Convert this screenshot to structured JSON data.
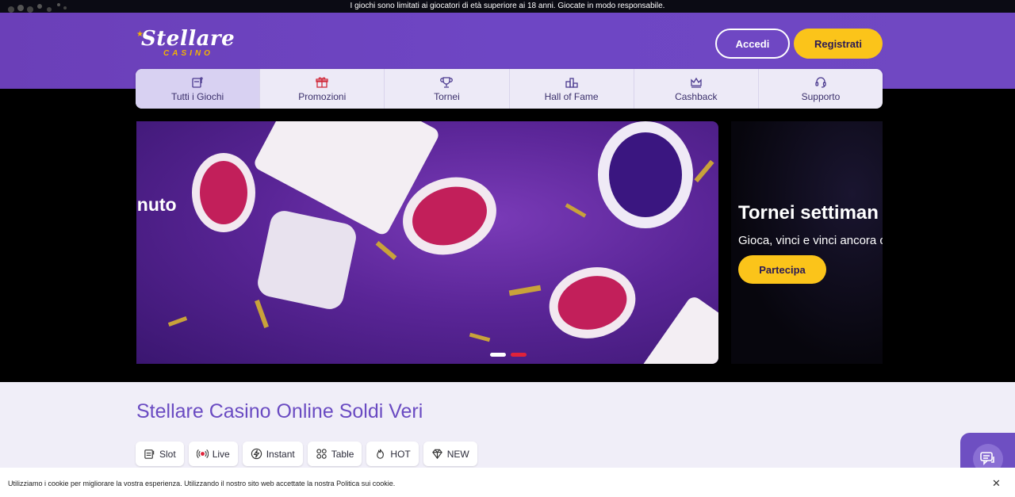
{
  "topbar": {
    "notice": "I giochi sono limitati ai giocatori di età superiore ai 18 anni. Giocate in modo responsabile."
  },
  "logo": {
    "main": "Stellare",
    "sub": "CASINO"
  },
  "header": {
    "login_label": "Accedi",
    "register_label": "Registrati"
  },
  "nav": {
    "items": [
      {
        "label": "Tutti i Giochi",
        "icon": "slot-machine-icon",
        "active": true
      },
      {
        "label": "Promozioni",
        "icon": "gift-icon",
        "active": false
      },
      {
        "label": "Tornei",
        "icon": "trophy-icon",
        "active": false
      },
      {
        "label": "Hall of Fame",
        "icon": "podium-icon",
        "active": false
      },
      {
        "label": "Cashback",
        "icon": "crown-icon",
        "active": false
      },
      {
        "label": "Supporto",
        "icon": "headset-icon",
        "active": false
      }
    ]
  },
  "banner": {
    "partial_text": "enuto",
    "pager_active_index": 1
  },
  "banner2": {
    "title": "Tornei settiman",
    "subtitle": "Gioca, vinci e vinci ancora c",
    "cta_label": "Partecipa"
  },
  "section": {
    "title": "Stellare Casino Online Soldi Veri"
  },
  "categories": [
    {
      "label": "Slot",
      "icon": "slot-icon"
    },
    {
      "label": "Live",
      "icon": "live-icon"
    },
    {
      "label": "Instant",
      "icon": "lightning-icon"
    },
    {
      "label": "Table",
      "icon": "table-chips-icon"
    },
    {
      "label": "HOT",
      "icon": "flame-icon"
    },
    {
      "label": "NEW",
      "icon": "diamond-icon"
    }
  ],
  "cookie": {
    "text": "Utilizziamo i cookie per migliorare la vostra esperienza. Utilizzando il nostro sito web accettate la nostra Politica sui cookie.",
    "close": "✕"
  },
  "colors": {
    "brand_purple": "#6e46c4",
    "accent_yellow": "#fbc41a",
    "pager_red": "#e0223a"
  }
}
